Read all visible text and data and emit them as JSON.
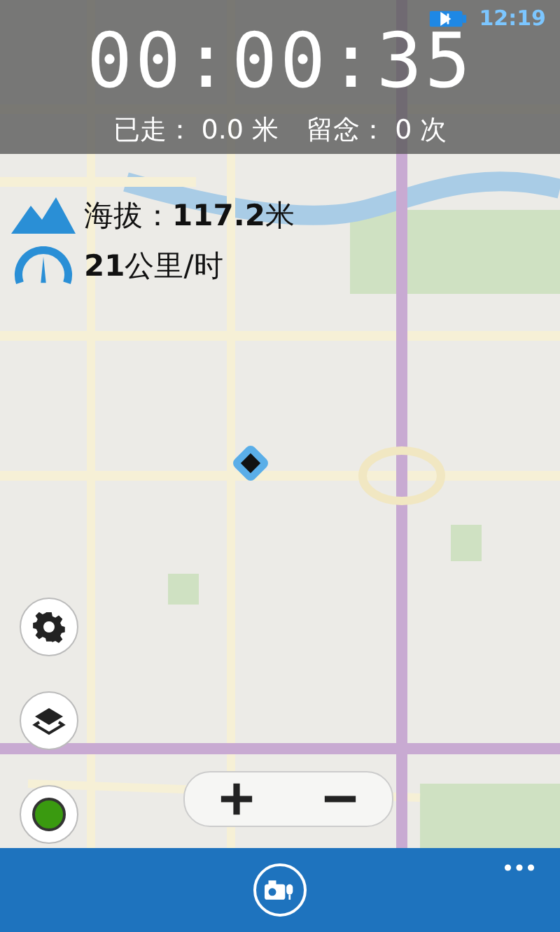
{
  "status_bar": {
    "time": "12:19"
  },
  "timer": "00:00:35",
  "trip_stats": [
    {
      "label": "已走：",
      "value": "0.0 米"
    },
    {
      "label": "留念：",
      "value": "0 次"
    }
  ],
  "altitude": "海拔：**117.2**米",
  "speed": "**21**公里/时",
  "recording": true
}
